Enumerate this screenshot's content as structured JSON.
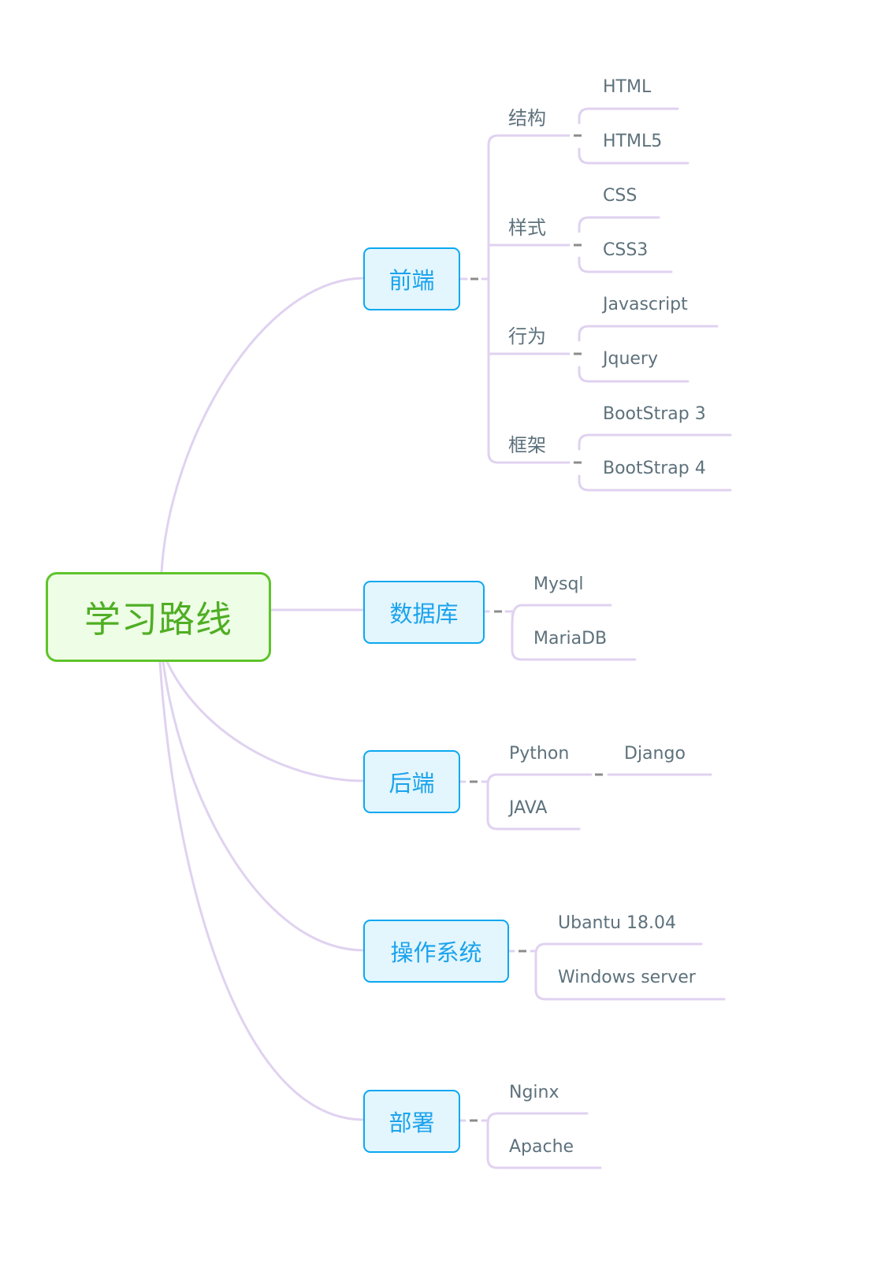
{
  "title": "学习路线",
  "colors": {
    "root_border": "#5ec42a",
    "root_fill": "#eefde6",
    "root_text": "#4fae24",
    "main_border": "#0aa8f0",
    "main_fill": "#e3f5fd",
    "main_text": "#1aa3ec",
    "connector": "#e0d2f0",
    "collapse_dash": "#8c8c8c",
    "leaf_text": "#5d717c"
  },
  "branches": [
    {
      "label": "前端",
      "children": [
        {
          "label": "结构",
          "children": [
            "HTML",
            "HTML5"
          ]
        },
        {
          "label": "样式",
          "children": [
            "CSS",
            "CSS3"
          ]
        },
        {
          "label": "行为",
          "children": [
            "Javascript",
            "Jquery"
          ]
        },
        {
          "label": "框架",
          "children": [
            "BootStrap 3",
            "BootStrap 4"
          ]
        }
      ]
    },
    {
      "label": "数据库",
      "children": [
        {
          "label": "Mysql"
        },
        {
          "label": "MariaDB"
        }
      ]
    },
    {
      "label": "后端",
      "children": [
        {
          "label": "Python",
          "children": [
            "Django"
          ]
        },
        {
          "label": "JAVA"
        }
      ]
    },
    {
      "label": "操作系统",
      "children": [
        {
          "label": "Ubantu 18.04"
        },
        {
          "label": "Windows server"
        }
      ]
    },
    {
      "label": "部署",
      "children": [
        {
          "label": "Nginx"
        },
        {
          "label": "Apache"
        }
      ]
    }
  ]
}
